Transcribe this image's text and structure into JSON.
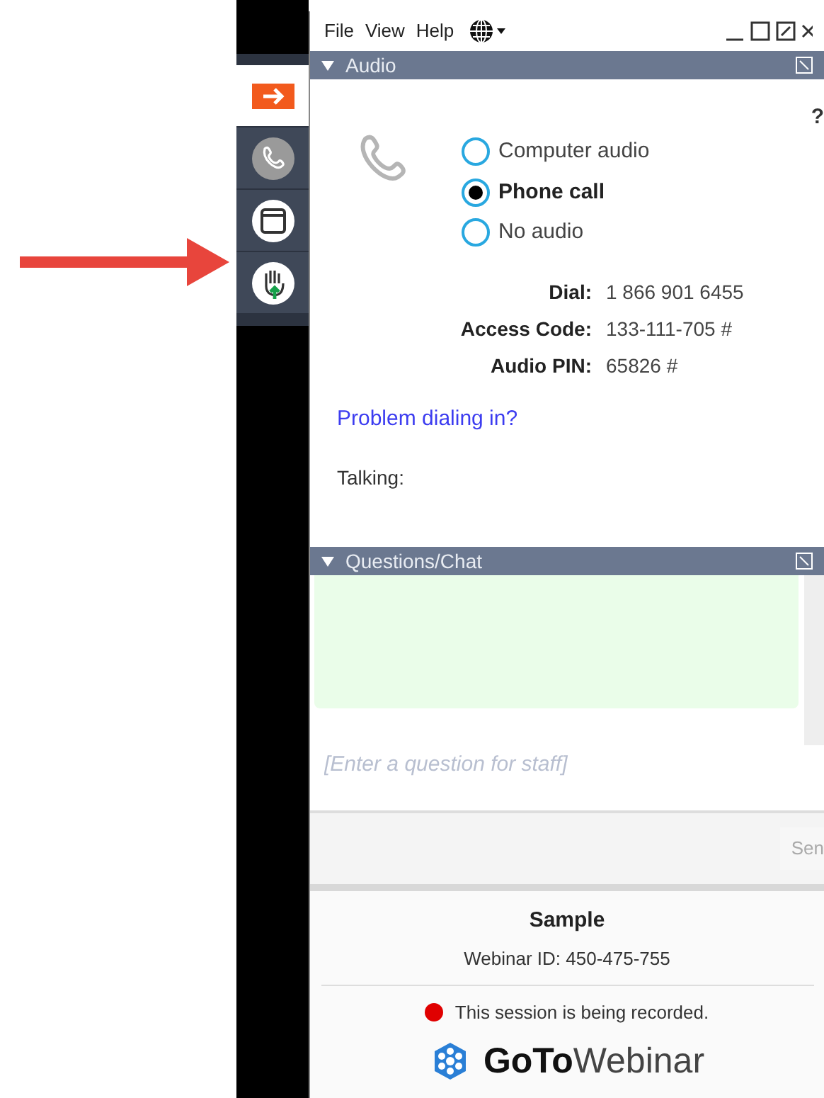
{
  "sidebar": {
    "items": [
      {
        "kind": "arrow",
        "selected": true
      },
      {
        "kind": "phone",
        "selected": false
      },
      {
        "kind": "window",
        "selected": false
      },
      {
        "kind": "hand",
        "selected": false
      }
    ]
  },
  "menu": [
    "File",
    "View",
    "Help"
  ],
  "audio": {
    "title": "Audio",
    "expanded": true,
    "help": "?",
    "options": [
      {
        "label": "Computer audio",
        "selected": false
      },
      {
        "label": "Phone call",
        "selected": true
      },
      {
        "label": "No audio",
        "selected": false
      }
    ],
    "details": [
      {
        "label": "Dial:",
        "value": "1 866 901 6455"
      },
      {
        "label": "Access Code:",
        "value": "133-111-705 #"
      },
      {
        "label": "Audio PIN:",
        "value": "65826 #"
      }
    ],
    "link": "Problem dialing in?",
    "talking": "Talking:"
  },
  "chat": {
    "title": "Questions/Chat",
    "expanded": true,
    "placeholder": "[Enter a question for staff]",
    "send": "Sen"
  },
  "footer": {
    "name": "Sample",
    "webinar_id": "Webinar ID: 450-475-755",
    "recording": {
      "text": "This session is being recorded.",
      "color": "#e00000"
    },
    "logo_bold": "GoTo",
    "logo_light": "Webinar"
  }
}
